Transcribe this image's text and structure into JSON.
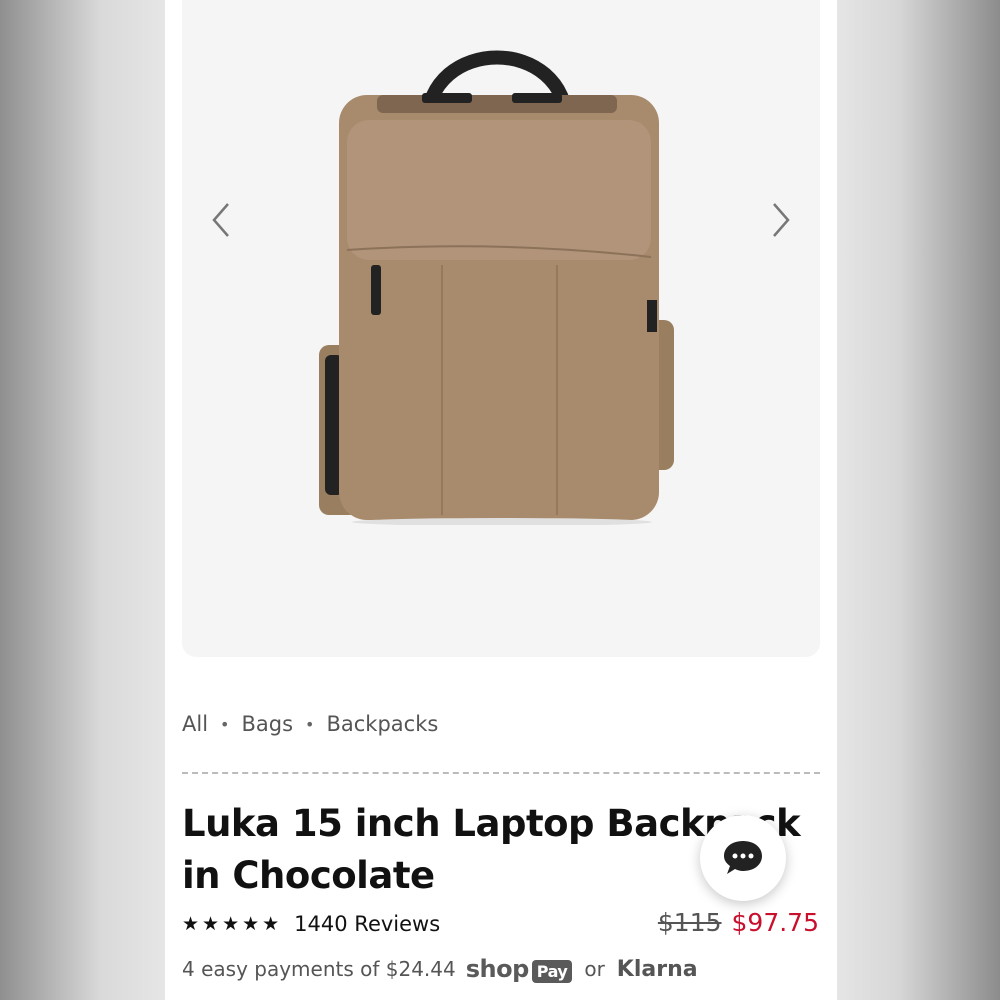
{
  "breadcrumb": {
    "items": [
      "All",
      "Bags",
      "Backpacks"
    ],
    "separator": "•"
  },
  "product": {
    "title": "Luka 15 inch Laptop Backpack in Chocolate",
    "rating_stars": 5,
    "reviews_text": "1440 Reviews",
    "old_price": "$115",
    "new_price": "$97.75",
    "image_color": "#a88b6c"
  },
  "payments": {
    "text": "4 easy payments of $24.44",
    "shop": "shop",
    "pay": "Pay",
    "or": "or",
    "klarna": "Klarna"
  },
  "icons": {
    "prev": "chevron-left-icon",
    "next": "chevron-right-icon",
    "chat": "chat-bubble-icon"
  },
  "colors": {
    "sale_price": "#c8102e",
    "gallery_bg": "#f5f5f5"
  }
}
